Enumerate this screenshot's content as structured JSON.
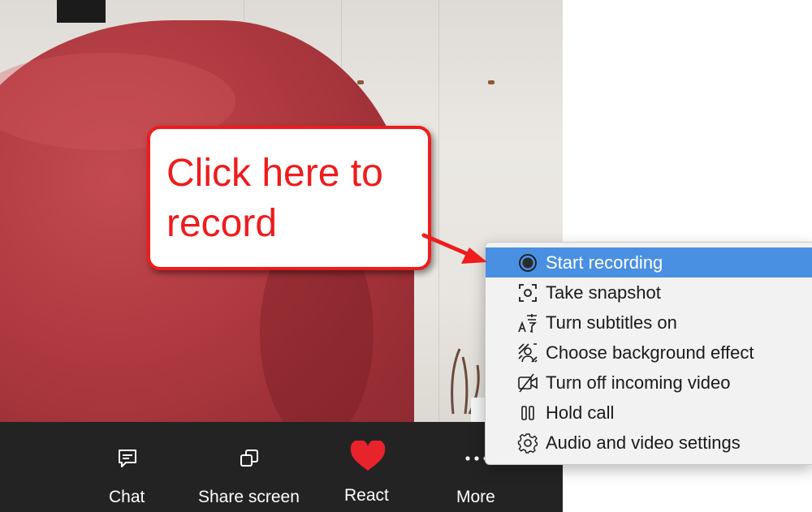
{
  "toolbar": {
    "buttons": [
      {
        "label": "Chat",
        "icon": "chat-icon"
      },
      {
        "label": "Share screen",
        "icon": "share-screen-icon"
      },
      {
        "label": "React",
        "icon": "heart-icon"
      },
      {
        "label": "More",
        "icon": "more-icon"
      }
    ]
  },
  "menu": {
    "items": [
      {
        "label": "Start recording",
        "icon": "record-icon",
        "selected": true
      },
      {
        "label": "Take snapshot",
        "icon": "snapshot-icon"
      },
      {
        "label": "Turn subtitles on",
        "icon": "subtitles-icon"
      },
      {
        "label": "Choose background effect",
        "icon": "background-effect-icon"
      },
      {
        "label": "Turn off incoming video",
        "icon": "video-off-icon"
      },
      {
        "label": "Hold call",
        "icon": "hold-icon"
      },
      {
        "label": "Audio and video settings",
        "icon": "gear-icon"
      }
    ]
  },
  "callout": {
    "line1": "Click here to",
    "line2": "record"
  },
  "colors": {
    "toolbar_bg": "#232323",
    "highlight": "#4a90e2",
    "callout_red": "#ee1c1c",
    "react_red": "#e8232b"
  }
}
